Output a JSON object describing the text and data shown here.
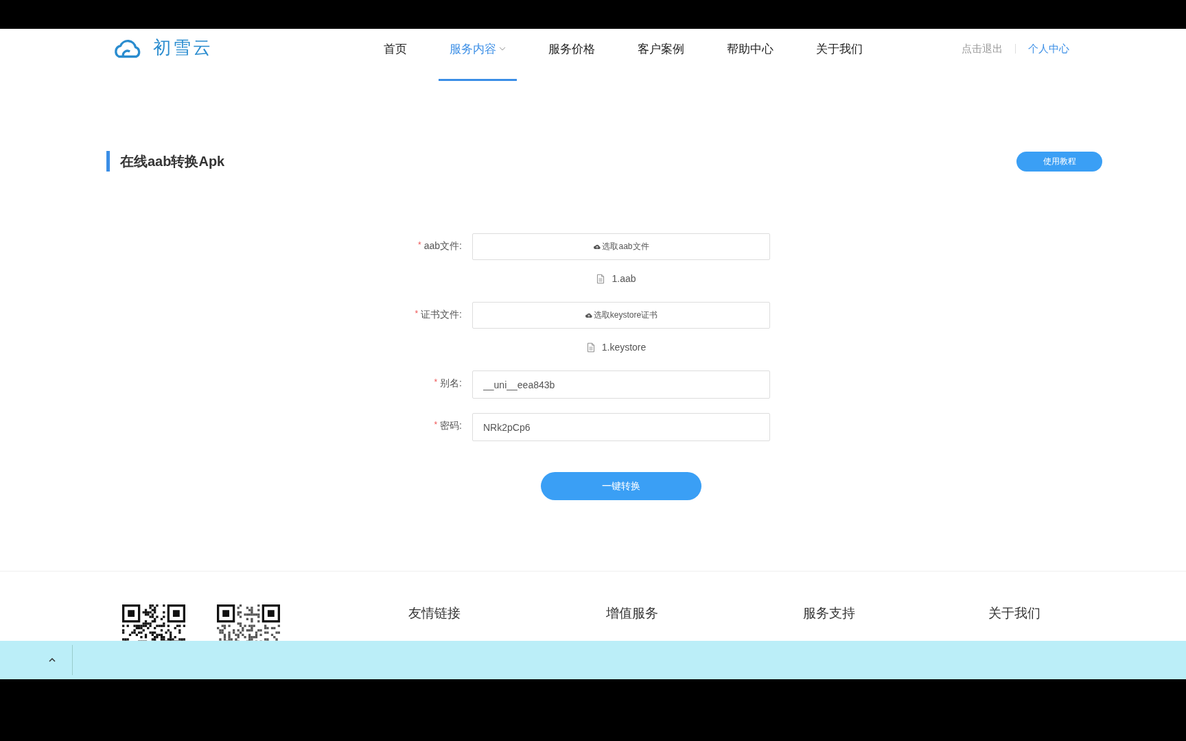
{
  "header": {
    "logo_text": "初雪云",
    "nav": [
      {
        "label": "首页",
        "selected": false,
        "dropdown": false
      },
      {
        "label": "服务内容",
        "selected": true,
        "dropdown": true
      },
      {
        "label": "服务价格",
        "selected": false,
        "dropdown": false
      },
      {
        "label": "客户案例",
        "selected": false,
        "dropdown": false
      },
      {
        "label": "帮助中心",
        "selected": false,
        "dropdown": false
      },
      {
        "label": "关于我们",
        "selected": false,
        "dropdown": false
      }
    ],
    "user_links": [
      {
        "label": "点击退出",
        "selected": false
      },
      {
        "label": "个人中心",
        "selected": true
      }
    ]
  },
  "page_title": "在线aab转换Apk",
  "tutorial_button": "使用教程",
  "form": {
    "fields": [
      {
        "kind": "file",
        "required_mark": "*",
        "label": "aab文件:",
        "button_label": "选取aab文件",
        "file_name": "1.aab"
      },
      {
        "kind": "file",
        "required_mark": "*",
        "label": "证书文件:",
        "button_label": "选取keystore证书",
        "file_name": "1.keystore"
      },
      {
        "kind": "text",
        "required_mark": "*",
        "label": "别名:",
        "value": "__uni__eea843b"
      },
      {
        "kind": "text",
        "required_mark": "*",
        "label": "密码:",
        "value": "NRk2pCp6"
      }
    ],
    "submit_button": "一键转换"
  },
  "footer": {
    "columns": [
      {
        "heading": "友情链接"
      },
      {
        "heading": "增值服务"
      },
      {
        "heading": "服务支持"
      },
      {
        "heading": "关于我们"
      }
    ]
  }
}
